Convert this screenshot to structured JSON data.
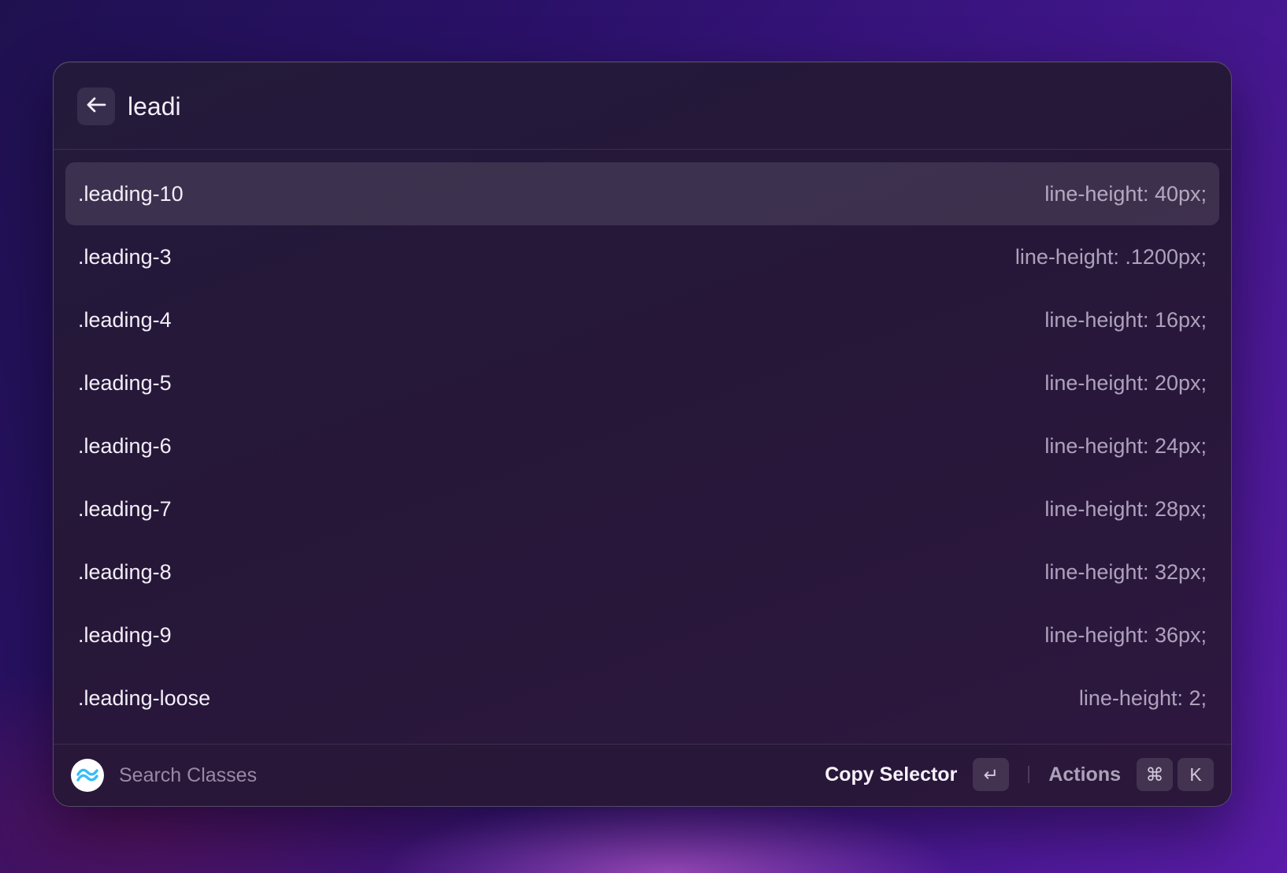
{
  "header": {
    "back_icon": "arrow-left-icon",
    "query": "leadi"
  },
  "results": [
    {
      "selector": ".leading-10",
      "declaration": "line-height: 40px;",
      "selected": true
    },
    {
      "selector": ".leading-3",
      "declaration": "line-height: .1200px;"
    },
    {
      "selector": ".leading-4",
      "declaration": "line-height: 16px;"
    },
    {
      "selector": ".leading-5",
      "declaration": "line-height: 20px;"
    },
    {
      "selector": ".leading-6",
      "declaration": "line-height: 24px;"
    },
    {
      "selector": ".leading-7",
      "declaration": "line-height: 28px;"
    },
    {
      "selector": ".leading-8",
      "declaration": "line-height: 32px;"
    },
    {
      "selector": ".leading-9",
      "declaration": "line-height: 36px;"
    },
    {
      "selector": ".leading-loose",
      "declaration": "line-height: 2;"
    }
  ],
  "footer": {
    "logo_icon": "tailwind-logo-icon",
    "title": "Search Classes",
    "primary_action": "Copy Selector",
    "primary_key": "↵",
    "secondary_action": "Actions",
    "secondary_keys": [
      "⌘",
      "K"
    ]
  },
  "colors": {
    "accent_logo": "#38bdf8",
    "window_bg": "#261738",
    "selected_row_bg": "rgba(255,255,255,0.11)"
  }
}
